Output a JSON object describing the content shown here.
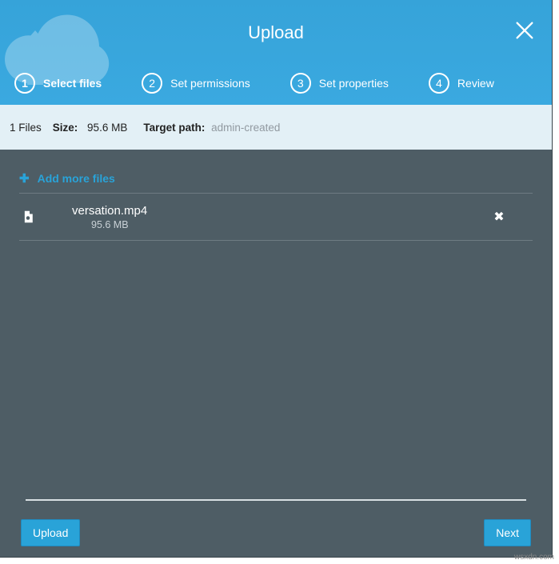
{
  "header": {
    "title": "Upload"
  },
  "steps": [
    {
      "num": "1",
      "label": "Select files"
    },
    {
      "num": "2",
      "label": "Set permissions"
    },
    {
      "num": "3",
      "label": "Set properties"
    },
    {
      "num": "4",
      "label": "Review"
    }
  ],
  "meta": {
    "files_count": "1 Files",
    "size_label": "Size:",
    "size_value": "95.6 MB",
    "target_label": "Target path:",
    "target_value": "admin-created"
  },
  "actions": {
    "add_more": "Add more files"
  },
  "files": [
    {
      "name": "versation.mp4",
      "size": "95.6 MB"
    }
  ],
  "footer": {
    "upload_label": "Upload",
    "next_label": "Next"
  },
  "watermark": "wsxdn.com"
}
